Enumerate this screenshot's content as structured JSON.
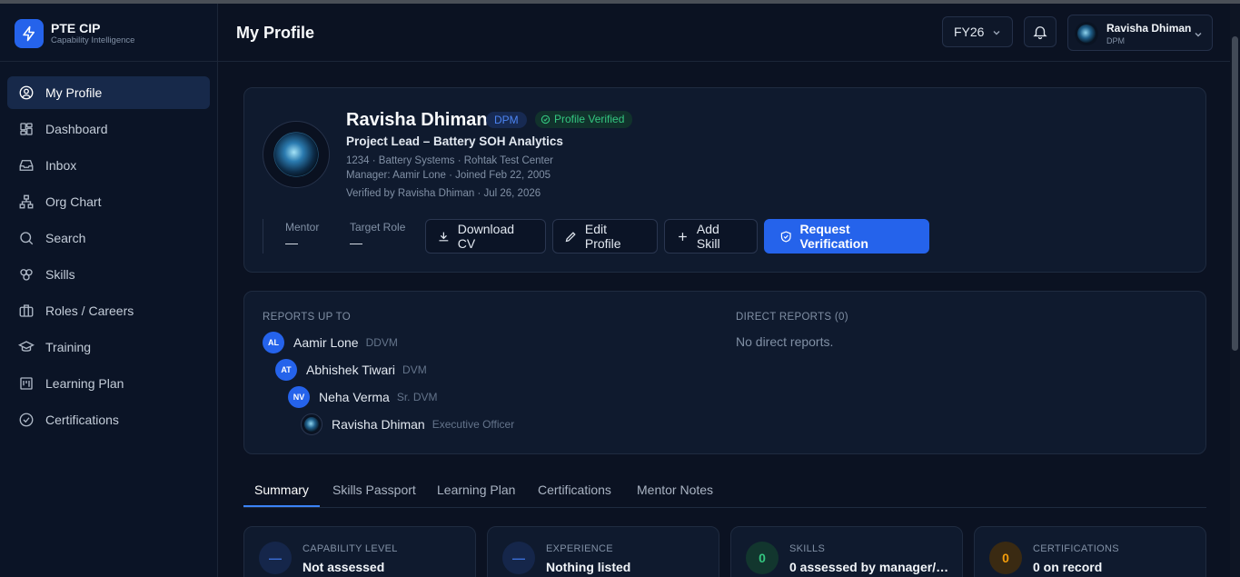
{
  "app": {
    "name": "PTE CIP",
    "subtitle": "Capability Intelligence"
  },
  "sidebar": {
    "items": [
      {
        "label": "My Profile",
        "icon": "user-circle-icon",
        "active": true
      },
      {
        "label": "Dashboard",
        "icon": "dashboard-grid-icon"
      },
      {
        "label": "Inbox",
        "icon": "inbox-icon"
      },
      {
        "label": "Org Chart",
        "icon": "org-chart-icon"
      },
      {
        "label": "Search",
        "icon": "search-icon"
      },
      {
        "label": "Skills",
        "icon": "skills-icon"
      },
      {
        "label": "Roles / Careers",
        "icon": "briefcase-icon"
      },
      {
        "label": "Training",
        "icon": "graduation-cap-icon"
      },
      {
        "label": "Learning Plan",
        "icon": "kanban-icon"
      },
      {
        "label": "Certifications",
        "icon": "check-circle-icon"
      }
    ]
  },
  "header": {
    "title": "My Profile",
    "fiscal_year": "FY26",
    "user": {
      "name": "Ravisha Dhiman",
      "role": "DPM"
    }
  },
  "profile": {
    "name": "Ravisha Dhiman",
    "grade_badge": "DPM",
    "verified_badge": "Profile Verified",
    "title": "Project Lead – Battery SOH Analytics",
    "meta_line1": "1234 · Battery Systems · Rohtak Test Center",
    "meta_line2": "Manager: Aamir Lone · Joined Feb 22, 2005",
    "meta_line3": "Verified by Ravisha Dhiman · Jul 26, 2026",
    "mentor_label": "Mentor",
    "mentor_value": "—",
    "target_role_label": "Target Role",
    "target_role_value": "—",
    "buttons": {
      "download_cv": "Download CV",
      "edit_profile": "Edit Profile",
      "add_skill": "Add Skill",
      "request_verification": "Request Verification"
    }
  },
  "org": {
    "reports_up_to_label": "REPORTS UP TO",
    "chain": [
      {
        "initials": "AL",
        "name": "Aamir Lone",
        "role": "DDVM"
      },
      {
        "initials": "AT",
        "name": "Abhishek Tiwari",
        "role": "DVM"
      },
      {
        "initials": "NV",
        "name": "Neha Verma",
        "role": "Sr. DVM"
      },
      {
        "initials": "",
        "name": "Ravisha Dhiman",
        "role": "Executive Officer"
      }
    ],
    "direct_reports_label": "DIRECT REPORTS (0)",
    "no_direct_reports": "No direct reports."
  },
  "tabs": [
    "Summary",
    "Skills Passport",
    "Learning Plan",
    "Certifications",
    "Mentor Notes"
  ],
  "summary_cards": [
    {
      "icon_text": "—",
      "label": "CAPABILITY LEVEL",
      "value": "Not assessed",
      "color": "#3b6fd8"
    },
    {
      "icon_text": "—",
      "label": "EXPERIENCE",
      "value": "Nothing listed",
      "color": "#3b6fd8"
    },
    {
      "icon_text": "0",
      "label": "SKILLS",
      "value": "0 assessed by manager/…",
      "color": "#34c780"
    },
    {
      "icon_text": "0",
      "label": "CERTIFICATIONS",
      "value": "0 on record",
      "color": "#f59e0b"
    }
  ]
}
